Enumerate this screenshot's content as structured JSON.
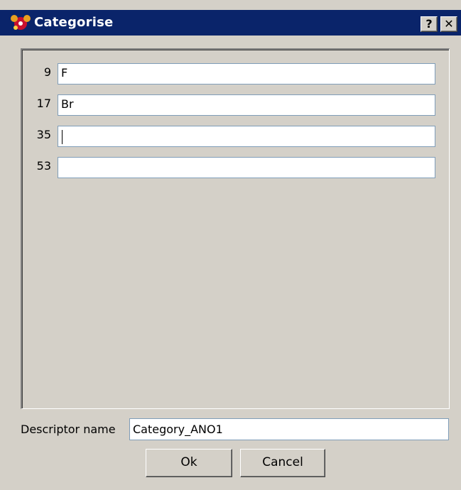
{
  "window": {
    "title": "Categorise",
    "help_button": "?",
    "close_button": "✕"
  },
  "rows": [
    {
      "number": "9",
      "value": "F"
    },
    {
      "number": "17",
      "value": "Br"
    },
    {
      "number": "35",
      "value": ""
    },
    {
      "number": "53",
      "value": ""
    }
  ],
  "descriptor": {
    "label": "Descriptor name",
    "value": "Category_ANO1"
  },
  "buttons": {
    "ok": "Ok",
    "cancel": "Cancel"
  },
  "colors": {
    "titlebar": "#0a246a",
    "dialog_bg": "#d4d0c8"
  }
}
